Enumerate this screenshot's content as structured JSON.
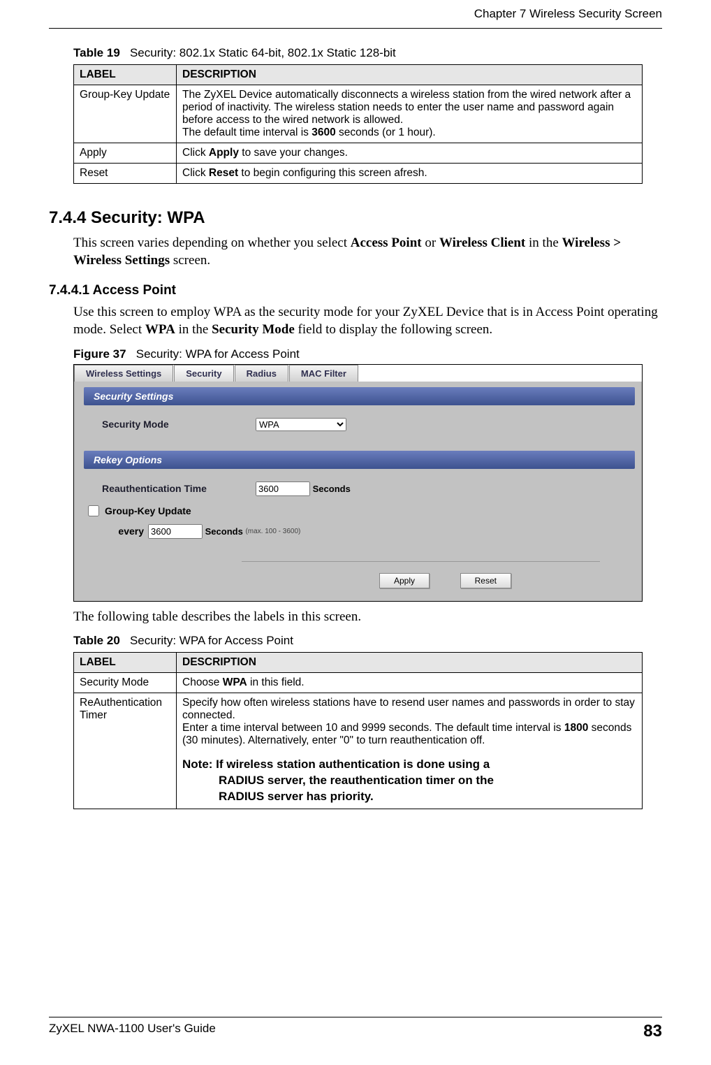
{
  "header": {
    "chapter": "Chapter 7 Wireless Security Screen"
  },
  "table19": {
    "caption_label": "Table 19",
    "caption_text": "Security: 802.1x Static 64-bit, 802.1x Static 128-bit",
    "col1": "LABEL",
    "col2": "DESCRIPTION",
    "rows": [
      {
        "label": "Group-Key Update",
        "desc_line1": "The ZyXEL Device automatically disconnects a wireless station from the wired network after a period of inactivity. The wireless station needs to enter the user name and password again before access to the wired network is allowed.",
        "desc_line2a": "The default time interval is ",
        "desc_line2b": "3600",
        "desc_line2c": " seconds (or 1 hour)."
      },
      {
        "label": "Apply",
        "desc_a": "Click ",
        "desc_b": "Apply",
        "desc_c": " to save your changes."
      },
      {
        "label": "Reset",
        "desc_a": "Click ",
        "desc_b": "Reset",
        "desc_c": " to begin configuring this screen afresh."
      }
    ]
  },
  "sec744": {
    "heading": "7.4.4  Security: WPA",
    "p1a": "This screen varies depending on whether you select ",
    "p1b": "Access Point",
    "p1c": " or ",
    "p1d": "Wireless Client",
    "p1e": " in the ",
    "p1f": "Wireless > Wireless Settings",
    "p1g": " screen."
  },
  "sec7441": {
    "heading": "7.4.4.1  Access Point",
    "p1a": "Use this screen to employ WPA as the security mode for your ZyXEL Device that is in Access Point operating mode. Select ",
    "p1b": "WPA",
    "p1c": " in the ",
    "p1d": "Security Mode",
    "p1e": " field to display the following screen."
  },
  "figure37": {
    "label": "Figure 37",
    "text": "Security: WPA for Access Point"
  },
  "screenshot": {
    "tabs": [
      "Wireless Settings",
      "Security",
      "Radius",
      "MAC Filter"
    ],
    "band1": "Security Settings",
    "sm_label": "Security Mode",
    "sm_value": "WPA",
    "band2": "Rekey Options",
    "reauth_label": "Reauthentication Time",
    "reauth_value": "3600",
    "seconds": "Seconds",
    "gku_label": "Group-Key Update",
    "every": "every",
    "gku_value": "3600",
    "seconds2": "Seconds",
    "max_note": "(max. 100 - 3600)",
    "apply": "Apply",
    "reset": "Reset"
  },
  "after_fig": "The following table describes the labels in this screen.",
  "table20": {
    "caption_label": "Table 20",
    "caption_text": "Security: WPA for Access Point",
    "col1": "LABEL",
    "col2": "DESCRIPTION",
    "rows": [
      {
        "label": "Security Mode",
        "d1": "Choose ",
        "d2": "WPA",
        "d3": " in this field."
      },
      {
        "label": "ReAuthentication Timer",
        "d1": "Specify how often wireless stations have to resend user names and passwords in order to stay connected.",
        "d2a": "Enter a time interval between 10 and 9999 seconds. The default time interval is ",
        "d2b": "1800",
        "d2c": " seconds (30 minutes). Alternatively, enter \"0\" to turn reauthentication off.",
        "note1": "Note: If wireless station authentication is done using a",
        "note2": "RADIUS server, the reauthentication timer on the",
        "note3": "RADIUS server has priority."
      }
    ]
  },
  "footer": {
    "guide": "ZyXEL NWA-1100 User's Guide",
    "page": "83"
  }
}
